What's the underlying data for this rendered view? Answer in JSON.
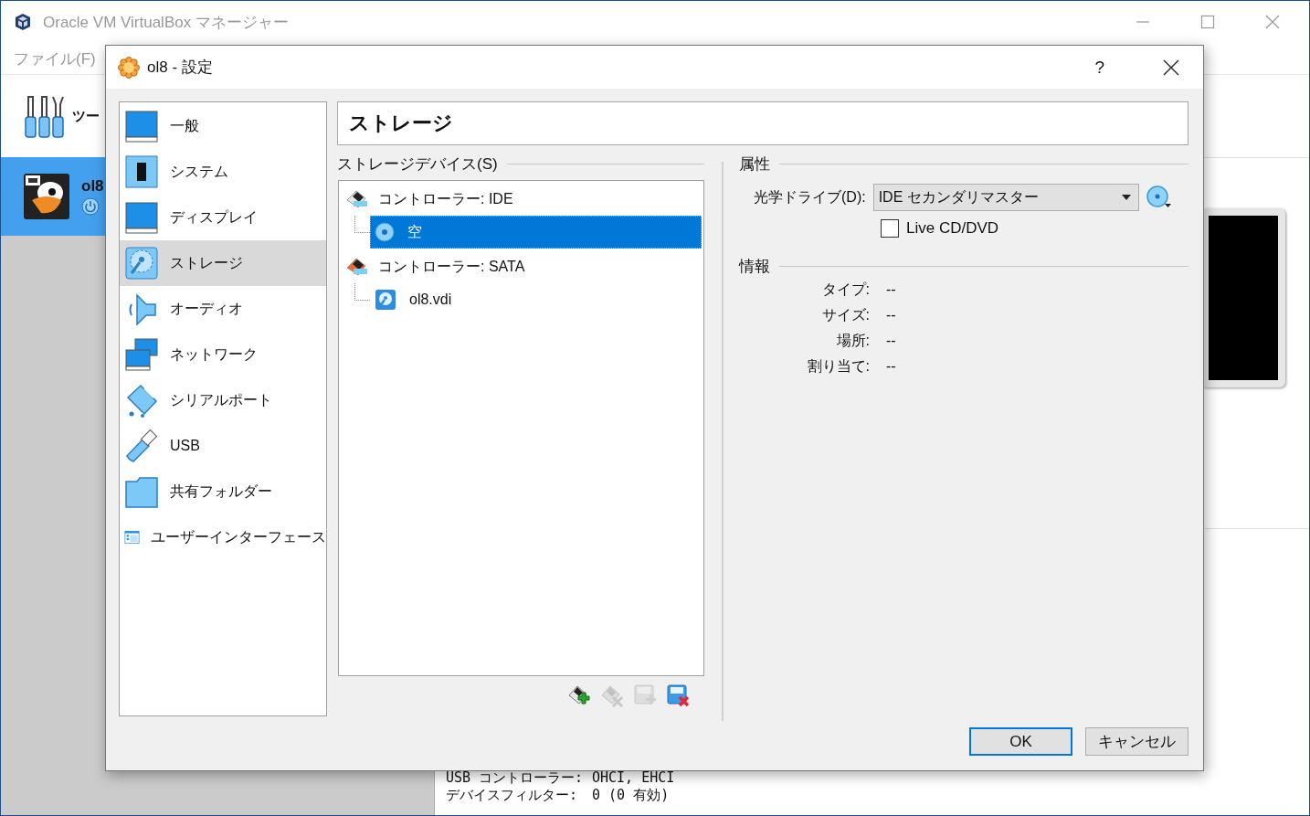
{
  "main_window": {
    "title": "Oracle VM VirtualBox マネージャー",
    "menu": [
      "ファイル(F)"
    ],
    "tools_label": "ツー",
    "vms": [
      {
        "name": "ol8",
        "selected": true
      }
    ],
    "details": [
      {
        "label": "USB コントローラー:",
        "value": "OHCI, EHCI"
      },
      {
        "label": "デバイスフィルター:",
        "value": "0 (0 有効)"
      }
    ]
  },
  "dialog": {
    "title": "ol8 - 設定",
    "help": "?",
    "categories": [
      {
        "label": "一般",
        "kind": "general",
        "selected": false
      },
      {
        "label": "システム",
        "kind": "system",
        "selected": false
      },
      {
        "label": "ディスプレイ",
        "kind": "display",
        "selected": false
      },
      {
        "label": "ストレージ",
        "kind": "storage",
        "selected": true
      },
      {
        "label": "オーディオ",
        "kind": "audio",
        "selected": false
      },
      {
        "label": "ネットワーク",
        "kind": "network",
        "selected": false
      },
      {
        "label": "シリアルポート",
        "kind": "serial",
        "selected": false
      },
      {
        "label": "USB",
        "kind": "usb",
        "selected": false
      },
      {
        "label": "共有フォルダー",
        "kind": "shared",
        "selected": false
      },
      {
        "label": "ユーザーインターフェース",
        "kind": "ui",
        "selected": false
      }
    ],
    "page_title": "ストレージ",
    "storage_devices": {
      "label": "ストレージデバイス(S)",
      "tree": [
        {
          "label": "コントローラー: IDE",
          "kind": "ide",
          "selected": false,
          "children": [
            {
              "label": "空",
              "kind": "optical",
              "selected": true
            }
          ]
        },
        {
          "label": "コントローラー: SATA",
          "kind": "sata",
          "selected": false,
          "children": [
            {
              "label": "ol8.vdi",
              "kind": "disk",
              "selected": false
            }
          ]
        }
      ],
      "toolbar": [
        {
          "kind": "add_controller",
          "disabled": false
        },
        {
          "kind": "remove_controller",
          "disabled": true
        },
        {
          "kind": "add_attachment",
          "disabled": true
        },
        {
          "kind": "remove_attachment",
          "disabled": false
        }
      ]
    },
    "attributes": {
      "label": "属性",
      "optical_drive": {
        "label": "光学ドライブ(D):",
        "value": "IDE セカンダリマスター"
      },
      "live_cd": {
        "label": "Live CD/DVD",
        "checked": false
      }
    },
    "info": {
      "label": "情報",
      "rows": [
        {
          "label": "タイプ:",
          "value": "--"
        },
        {
          "label": "サイズ:",
          "value": "--"
        },
        {
          "label": "場所:",
          "value": "--"
        },
        {
          "label": "割り当て:",
          "value": "--"
        }
      ]
    },
    "buttons": [
      {
        "label": "OK",
        "default": true
      },
      {
        "label": "キャンセル",
        "default": false
      }
    ]
  }
}
